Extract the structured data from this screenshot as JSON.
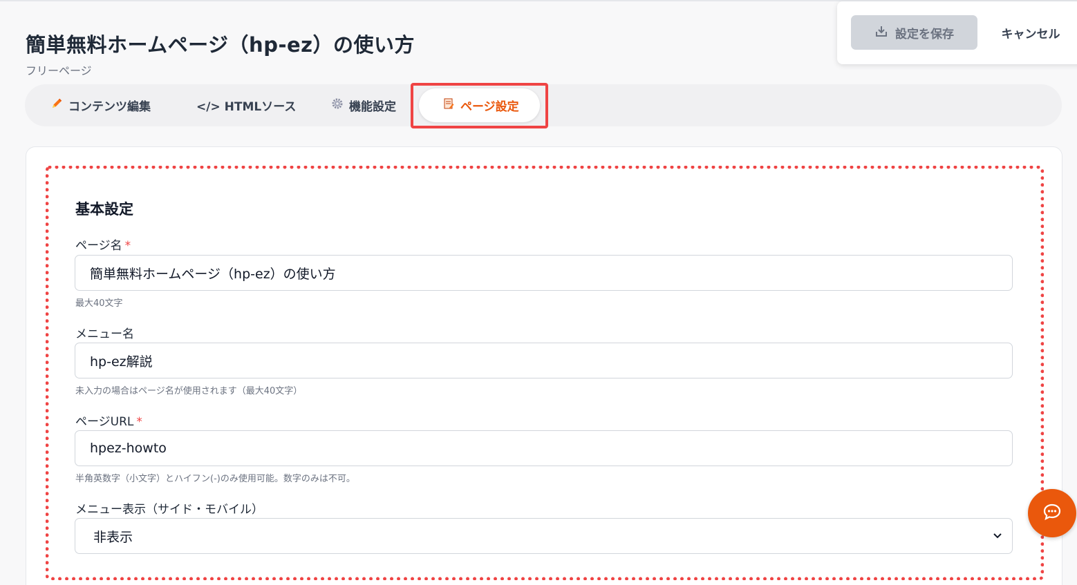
{
  "header": {
    "title": "簡単無料ホームページ（hp-ez）の使い方",
    "subtitle": "フリーページ"
  },
  "actions": {
    "save_label": "設定を保存",
    "cancel_label": "キャンセル"
  },
  "tabs": [
    {
      "label": "コンテンツ編集",
      "icon": "pencil-icon"
    },
    {
      "label": "</> HTMLソース",
      "icon": "code-icon"
    },
    {
      "label": "機能設定",
      "icon": "gear-icon"
    },
    {
      "label": "ページ設定",
      "icon": "page-icon",
      "active": true
    }
  ],
  "section": {
    "title": "基本設定"
  },
  "form": {
    "page_name": {
      "label": "ページ名",
      "required_mark": "*",
      "value": "簡単無料ホームページ（hp-ez）の使い方",
      "help": "最大40文字"
    },
    "menu_name": {
      "label": "メニュー名",
      "value": "hp-ez解説",
      "help": "未入力の場合はページ名が使用されます（最大40文字）"
    },
    "page_url": {
      "label": "ページURL",
      "required_mark": "*",
      "value": "hpez-howto",
      "help": "半角英数字（小文字）とハイフン(-)のみ使用可能。数字のみは不可。"
    },
    "menu_display": {
      "label": "メニュー表示（サイド・モバイル）",
      "selected": "非表示"
    }
  },
  "colors": {
    "accent": "#ea580c",
    "highlight": "#ef4444"
  }
}
